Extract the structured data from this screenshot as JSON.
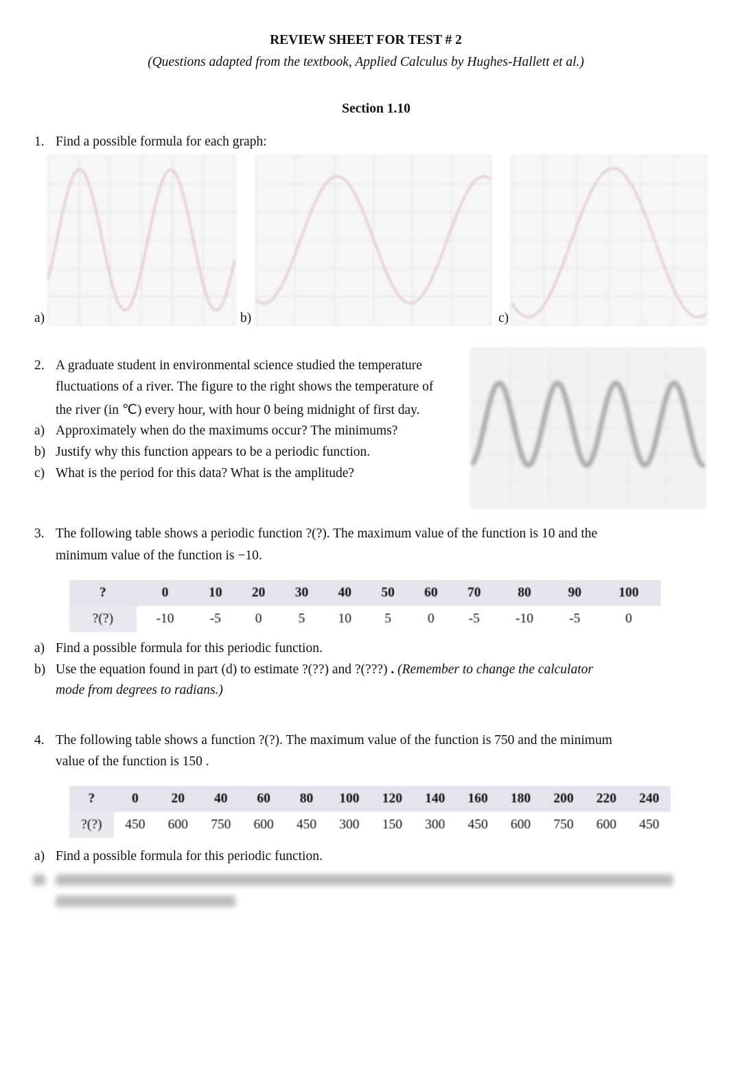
{
  "header": {
    "title": "REVIEW SHEET FOR TEST # 2",
    "subtitle": "(Questions adapted from the textbook, Applied Calculus by Hughes-Hallett et al.)",
    "section": "Section 1.10"
  },
  "q1": {
    "num": "1.",
    "text": "Find a possible formula for each graph:",
    "labels": [
      "a)",
      "b)",
      "c)"
    ],
    "curve_color": "#d9b3b3"
  },
  "q2": {
    "num": "2.",
    "lines": [
      "A graduate student in environmental science studied the temperature",
      "fluctuations of a river. The figure to the right shows the temperature of",
      "the river (in ℃) every hour, with hour 0 being midnight of first day."
    ],
    "parts": [
      {
        "label": "a)",
        "text": "Approximately when do the maximums occur? The minimums?"
      },
      {
        "label": "b)",
        "text": "Justify why this function appears to be a periodic function."
      },
      {
        "label": "c)",
        "text": "What is the period for this data? What is the amplitude?"
      }
    ]
  },
  "q3": {
    "num": "3.",
    "line1": "The following table shows a periodic function  ?(?).  The maximum value of the function is  10   and the",
    "line2": "minimum value of the function is  −10.",
    "table": {
      "header": [
        "?",
        "0",
        "10",
        "20",
        "30",
        "40",
        "50",
        "60",
        "70",
        "80",
        "90",
        "100"
      ],
      "row": [
        "?(?)",
        "-10",
        "-5",
        "0",
        "5",
        "10",
        "5",
        "0",
        "-5",
        "-10",
        "-5",
        "0"
      ]
    },
    "parts": [
      {
        "label": "a)",
        "text": "Find a possible formula for this periodic function."
      },
      {
        "label": "b)",
        "text": "Use the equation found in part (d) to estimate  ?(??)    and   ?(???)  ",
        "dot": ".",
        "note": " (Remember to change the calculator",
        "text2": "mode from degrees to radians.)"
      }
    ]
  },
  "q4": {
    "num": "4.",
    "line1": "The following table shows a function  ?(?).  The maximum value of the function is  750   and the minimum",
    "line2": "value of the function is  150 .",
    "table": {
      "header": [
        "?",
        "0",
        "20",
        "40",
        "60",
        "80",
        "100",
        "120",
        "140",
        "160",
        "180",
        "200",
        "220",
        "240"
      ],
      "row": [
        "?(?)",
        "450",
        "600",
        "750",
        "600",
        "450",
        "300",
        "150",
        "300",
        "450",
        "600",
        "750",
        "600",
        "450"
      ]
    },
    "parts": [
      {
        "label": "a)",
        "text": "Find a possible formula for this periodic function."
      }
    ]
  }
}
